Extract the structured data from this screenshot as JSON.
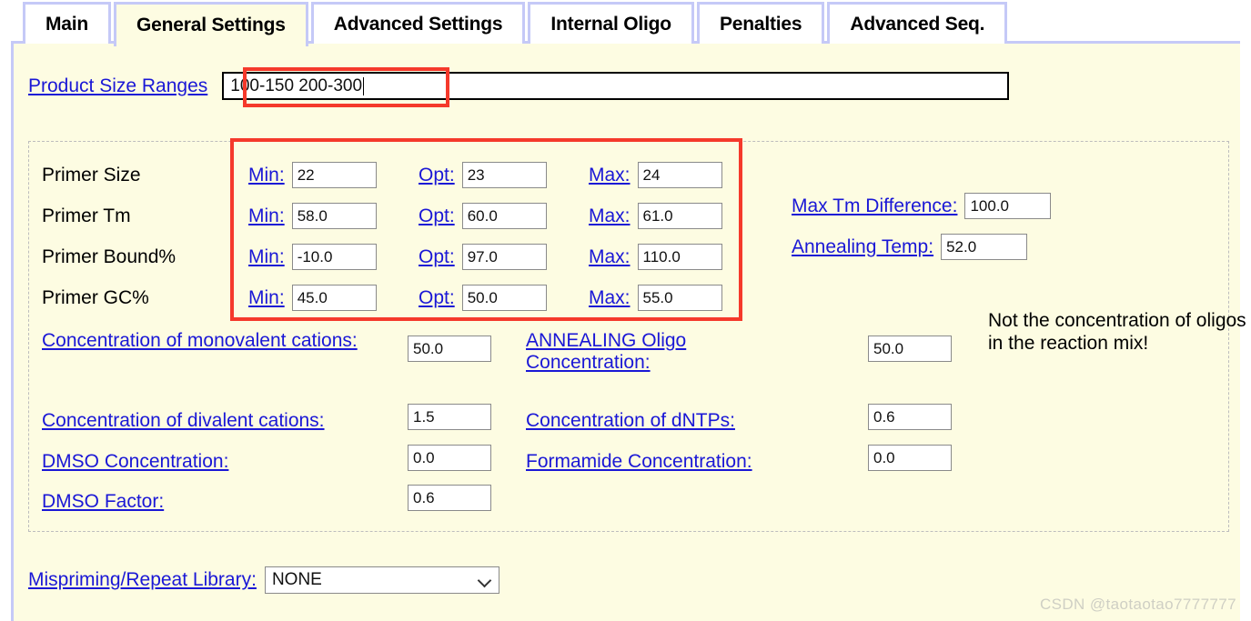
{
  "tabs": [
    {
      "label": "Main",
      "active": false
    },
    {
      "label": "General Settings",
      "active": true
    },
    {
      "label": "Advanced Settings",
      "active": false
    },
    {
      "label": "Internal Oligo",
      "active": false
    },
    {
      "label": "Penalties",
      "active": false
    },
    {
      "label": "Advanced Seq.",
      "active": false
    }
  ],
  "product_size": {
    "label": "Product Size Ranges",
    "value": "100-150 200-300"
  },
  "primer": {
    "col_labels": {
      "min": "Min:",
      "opt": "Opt:",
      "max": "Max:"
    },
    "rows": [
      {
        "name": "Primer Size",
        "min": "22",
        "opt": "23",
        "max": "24"
      },
      {
        "name": "Primer Tm",
        "min": "58.0",
        "opt": "60.0",
        "max": "61.0"
      },
      {
        "name": "Primer Bound%",
        "min": "-10.0",
        "opt": "97.0",
        "max": "110.0"
      },
      {
        "name": "Primer GC%",
        "min": "45.0",
        "opt": "50.0",
        "max": "55.0"
      }
    ]
  },
  "right_fields": {
    "max_tm_difference_label": "Max Tm Difference:",
    "max_tm_difference_value": "100.0",
    "annealing_temp_label": "Annealing Temp:",
    "annealing_temp_value": "52.0"
  },
  "concentrations": {
    "monovalent_label": "Concentration of monovalent cations:",
    "monovalent_value": "50.0",
    "annealing_oligo_label": "ANNEALING Oligo Concentration:",
    "annealing_oligo_value": "50.0",
    "note": "Not the concentration of oligos in the reaction mix!",
    "divalent_label": "Concentration of divalent cations:",
    "divalent_value": "1.5",
    "dntps_label": "Concentration of dNTPs:",
    "dntps_value": "0.6",
    "dmso_conc_label": "DMSO Concentration:",
    "dmso_conc_value": "0.0",
    "formamide_label": "Formamide Concentration:",
    "formamide_value": "0.0",
    "dmso_factor_label": "DMSO Factor:",
    "dmso_factor_value": "0.6"
  },
  "mispriming": {
    "label": "Mispriming/Repeat Library:",
    "selected": "NONE"
  },
  "watermark": "CSDN @taotaotao7777777",
  "colors": {
    "panel_bg": "#fdfce2",
    "panel_border": "#c5c9f7",
    "link": "#1a17d6",
    "annotation_red": "#f5392b"
  }
}
